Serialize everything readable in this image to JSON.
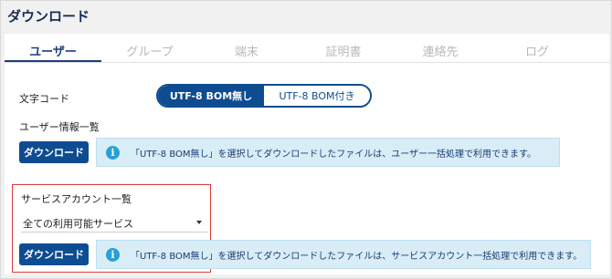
{
  "title": "ダウンロード",
  "tabs": [
    "ユーザー",
    "グループ",
    "端末",
    "証明書",
    "連絡先",
    "ログ"
  ],
  "char_code": {
    "label": "文字コード",
    "options": [
      "UTF-8 BOM無し",
      "UTF-8 BOM付き"
    ],
    "selected": "UTF-8 BOM無し"
  },
  "user_list": {
    "label": "ユーザー情報一覧",
    "button": "ダウンロード",
    "info": "「UTF-8 BOM無し」を選択してダウンロードしたファイルは、ユーザー一括処理で利用できます。"
  },
  "service_list": {
    "label": "サービスアカウント一覧",
    "select_value": "全ての利用可能サービス",
    "button": "ダウンロード",
    "info": "「UTF-8 BOM無し」を選択してダウンロードしたファイルは、サービスアカウント一括処理で利用できます。"
  },
  "colors": {
    "primary": "#0e4c92",
    "info_bg": "#d9edf7",
    "highlight": "#e03a3a"
  },
  "icons": [
    "info-icon",
    "chevron-down-icon"
  ]
}
